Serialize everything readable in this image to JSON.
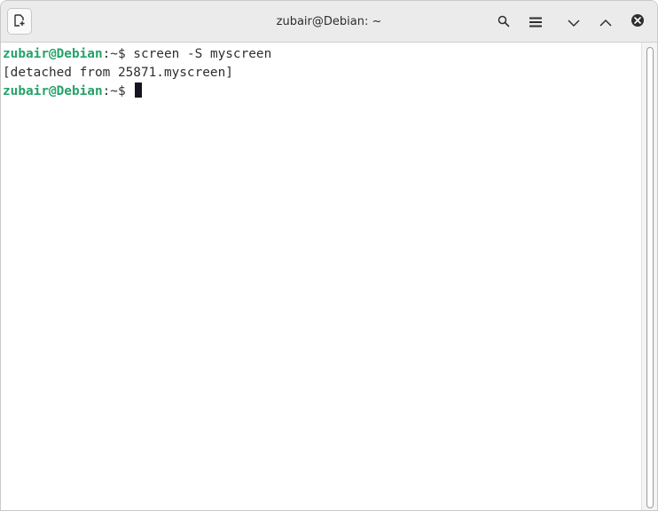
{
  "window": {
    "title": "zubair@Debian: ~"
  },
  "headerbar": {
    "new_tab_icon": "new-tab-icon",
    "search_icon": "search-icon",
    "menu_icon": "hamburger-menu-icon",
    "minimize_icon": "chevron-down-icon",
    "maximize_icon": "chevron-up-icon",
    "close_icon": "close-icon"
  },
  "terminal": {
    "lines": [
      {
        "user": "zubair@Debian",
        "path": ":~$",
        "command": " screen -S myscreen"
      },
      {
        "output": "[detached from 25871.myscreen]"
      },
      {
        "user": "zubair@Debian",
        "path": ":~$",
        "command": " "
      }
    ]
  },
  "colors": {
    "prompt_user": "#26a269",
    "text": "#2e2e2e",
    "background": "#ffffff",
    "headerbar": "#ebebeb"
  }
}
